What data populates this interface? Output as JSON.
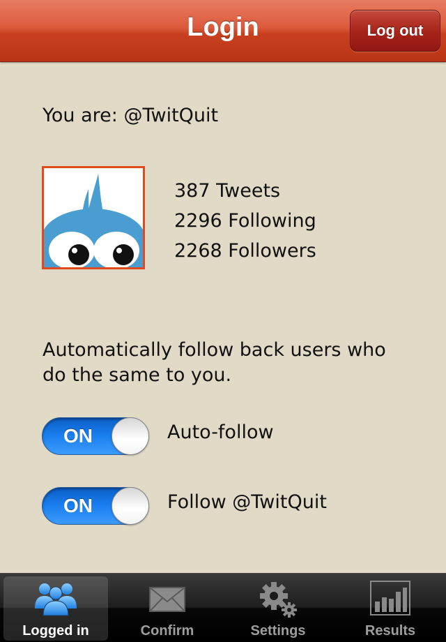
{
  "navbar": {
    "title": "Login",
    "logout_label": "Log out"
  },
  "account": {
    "you_are": "You are: @TwitQuit",
    "tweets": "387 Tweets",
    "following": "2296 Following",
    "followers": "2268 Followers"
  },
  "description": "Automatically follow back users who do the same to you.",
  "switches": [
    {
      "state_label": "ON",
      "label": "Auto-follow",
      "on": true
    },
    {
      "state_label": "ON",
      "label": "Follow @TwitQuit",
      "on": true
    }
  ],
  "tabs": [
    {
      "label": "Logged in",
      "icon": "users-icon",
      "active": true
    },
    {
      "label": "Confirm",
      "icon": "envelope-icon",
      "active": false
    },
    {
      "label": "Settings",
      "icon": "gears-icon",
      "active": false
    },
    {
      "label": "Results",
      "icon": "bar-chart-icon",
      "active": false
    }
  ],
  "colors": {
    "navbar": "#d24a2a",
    "background": "#e0dac7",
    "switch_on": "#1a7ff0",
    "avatar_border": "#e24a1e",
    "avatar_bird": "#4a9dd0"
  }
}
